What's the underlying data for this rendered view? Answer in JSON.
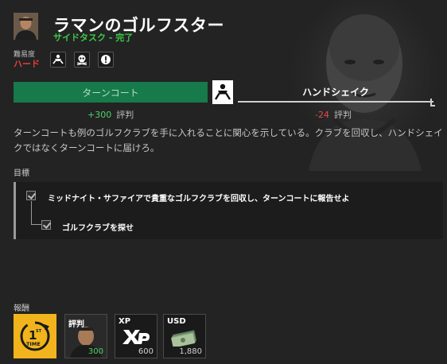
{
  "mission": {
    "title": "ラマンのゴルフスター",
    "type": "サイドタスク",
    "separator": "-",
    "status": "完了",
    "difficulty_label": "難易度",
    "difficulty_value": "ハード",
    "mission_icons": [
      "handshake-icon",
      "skull-icon",
      "alert-icon"
    ]
  },
  "choices": {
    "left_label": "ターンコート",
    "left_rep": "+300",
    "right_label": "ハンドシェイク",
    "right_rep": "-24",
    "rep_label": "評判",
    "center_icon": "handshake-icon"
  },
  "description": "ターンコートも例のゴルフクラブを手に入れることに関心を示している。クラブを回収し、ハンドシェイクではなくターンコートに届けろ。",
  "objectives": {
    "title": "目標",
    "items": [
      {
        "text": "ミッドナイト・サファイアで貴重なゴルフクラブを回収し、ターンコートに報告せよ",
        "done": true
      },
      {
        "text": "ゴルフクラブを探せ",
        "done": true
      }
    ]
  },
  "rewards": {
    "title": "報酬",
    "items": [
      {
        "label": "",
        "value": "",
        "icon": "first-time-icon"
      },
      {
        "label": "評判",
        "value": "300",
        "icon": "character-portrait"
      },
      {
        "label": "XP",
        "value": "600",
        "icon": "xp-icon"
      },
      {
        "label": "USD",
        "value": "1,880",
        "icon": "cash-icon"
      }
    ]
  },
  "colors": {
    "accent_green": "#177a4a",
    "status_green": "#3cc84a",
    "negative_red": "#e84a4a",
    "difficulty_red": "#e83c3c",
    "first_time_yellow": "#f2b41c"
  }
}
